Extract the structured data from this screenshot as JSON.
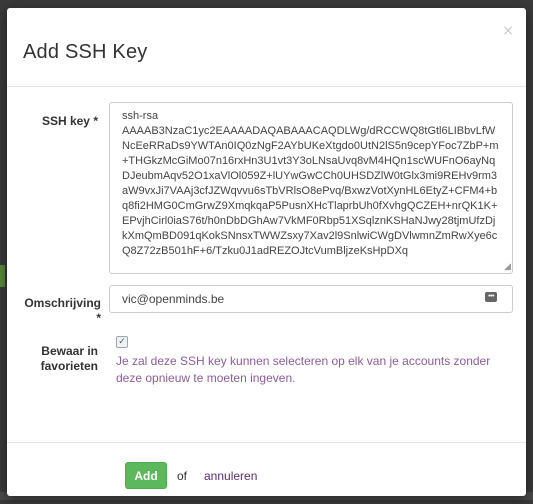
{
  "modal": {
    "title": "Add SSH Key",
    "close_symbol": "×"
  },
  "form": {
    "ssh_key": {
      "label": "SSH key *",
      "value": "ssh-rsa\nAAAAB3NzaC1yc2EAAAADAQABAAACAQDLWg/dRCCWQ8tGtl6LIBbvLfWNcEeRRaDs9YWTAn0IQ0zNgF2AYbUKeXtgdo0UtN2lS5n9cepYFoc7ZbP+m+THGkzMcGiMo07n16rxHn3U1vt3Y3oLNsaUvq8vM4HQn1scWUFnO6ayNqDJeubmAqv52O1xaVlOl059Z+lUYwGwCCh0UHSDZlW0tGlx3mi9REHv9rm3aW9vxJi7VAAj3cfJZWqvvu6sTbVRlsO8ePvq/BxwzVotXynHL6EtyZ+CFM4+bq8fi2HMG0CmGrwZ9XmqkqaP5PusnXHcTlaprbUh0fXvhgQCZEH+nrQK1K+EPvjhCirl0iaS76t/h0nDbDGhAw7VkMF0Rbp51XSqlznKSHaNJwy28tjmUfzDjkXmQmBD091qKokSNnsxTWWZsxy7Xav2l9SnlwiCWgDVlwmnZmRwXye6cQ8Z72zB501hF+6/Tzku0J1adREZOJtcVumBljzeKsHpDXq"
    },
    "description": {
      "label": "Omschrijving *",
      "value": "vic@openminds.be",
      "icon": "ellipsis-icon"
    },
    "favorite": {
      "label": "Bewaar in favorieten",
      "checked": true,
      "help": "Je zal deze SSH key kunnen selecteren op elk van je accounts zonder deze opnieuw te moeten ingeven."
    }
  },
  "footer": {
    "add_label": "Add",
    "or_text": "of",
    "cancel_label": "annuleren"
  },
  "colors": {
    "primary_button": "#5cb85c",
    "link": "#5b2d73",
    "help_text": "#8e5b9b"
  }
}
